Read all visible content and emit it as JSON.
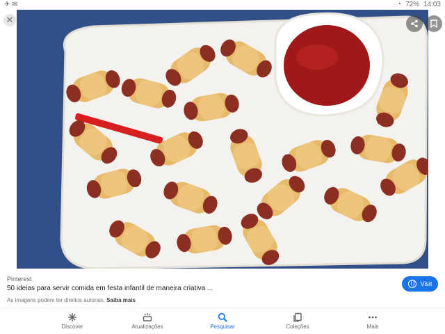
{
  "status": {
    "left": "✈ ✉",
    "battery": "72%",
    "time": "14:03"
  },
  "viewer": {
    "close_icon": "close-icon",
    "share_icon": "share-icon",
    "save_icon": "bookmark-icon",
    "photo_description_icon": "food-photo"
  },
  "result": {
    "source": "Pinterest",
    "title": "50 ideias para servir comida em festa infantil de maneira criativa ...",
    "rights_text": "As imagens podem ter direitos autorais.",
    "rights_link": "Saiba mais",
    "visit_label": "Visit"
  },
  "nav": {
    "items": [
      {
        "label": "Discover",
        "icon": "asterisk-icon"
      },
      {
        "label": "Atualizações",
        "icon": "updates-icon"
      },
      {
        "label": "Pesquisar",
        "icon": "search-icon",
        "active": true
      },
      {
        "label": "Coleções",
        "icon": "collections-icon"
      },
      {
        "label": "Mais",
        "icon": "more-icon"
      }
    ]
  },
  "colors": {
    "accent": "#1a73e8",
    "tablecloth": "#2f4f86",
    "platter": "#f4f2ee",
    "ketchup": "#a01818",
    "pastry": "#e7b96a",
    "sausage": "#8c2f22"
  }
}
